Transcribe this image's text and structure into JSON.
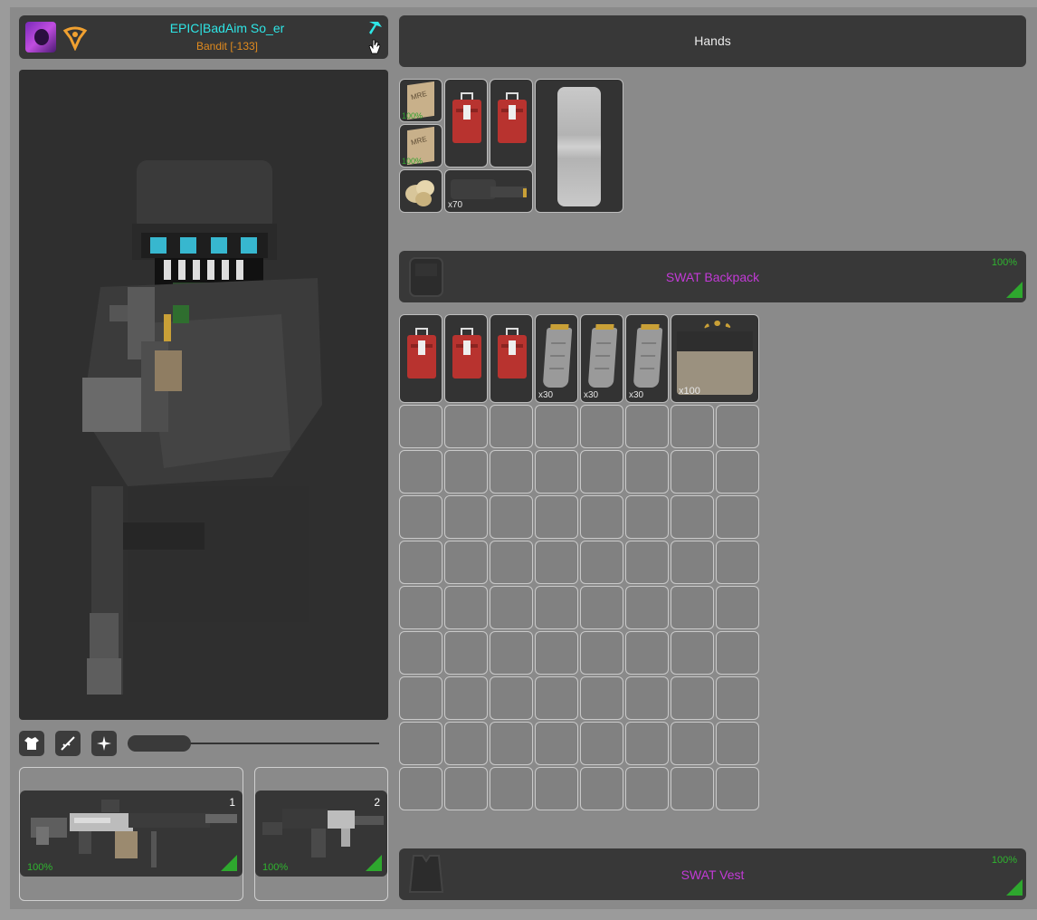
{
  "player": {
    "name": "EPIC|BadAim So_er",
    "rank": "Bandit [-133]",
    "name_color": "#2ee6e6",
    "rank_color": "#e08a1e"
  },
  "hands": {
    "label": "Hands"
  },
  "hands_items": {
    "mre_label": "MRE",
    "mre_cond_1": "100%",
    "mre_cond_2": "100%",
    "rounds_qty": "x70"
  },
  "backpack": {
    "label": "SWAT Backpack",
    "condition": "100%",
    "label_color": "#c23ad6",
    "items": [
      {
        "type": "medkit",
        "qty": ""
      },
      {
        "type": "medkit",
        "qty": ""
      },
      {
        "type": "medkit",
        "qty": ""
      },
      {
        "type": "magazine",
        "qty": "x30"
      },
      {
        "type": "magazine",
        "qty": "x30"
      },
      {
        "type": "magazine",
        "qty": "x30"
      },
      {
        "type": "ammo-box",
        "qty": "x100"
      }
    ],
    "grid": {
      "cols": 8,
      "rows": 9
    }
  },
  "vest": {
    "label": "SWAT Vest",
    "condition": "100%"
  },
  "weapons": [
    {
      "slot": "1",
      "condition": "100%"
    },
    {
      "slot": "2",
      "condition": "100%"
    }
  ],
  "character_tabs": [
    "shirt-icon",
    "rifle-icon",
    "sparkle-icon"
  ],
  "zoom_slider": {
    "value": 0.25
  }
}
